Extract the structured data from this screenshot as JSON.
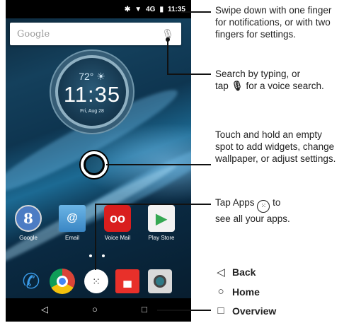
{
  "status_bar": {
    "time": "11:35",
    "icons": [
      "bluetooth-icon",
      "wifi-icon",
      "signal-4g-icon",
      "battery-icon"
    ],
    "network": "4G"
  },
  "search_bar": {
    "placeholder": "Google",
    "mic_icon": "mic-icon"
  },
  "clock_widget": {
    "temperature": "72°",
    "time": "11:35",
    "date": "Fri, Aug 28",
    "weather_icon": "sun-icon"
  },
  "apps": [
    {
      "label": "Google",
      "glyph": "8",
      "icon": "google-icon"
    },
    {
      "label": "Email",
      "glyph": "@",
      "icon": "email-icon"
    },
    {
      "label": "Voice Mail",
      "glyph": "oo",
      "icon": "voicemail-icon"
    },
    {
      "label": "Play Store",
      "glyph": "▶",
      "icon": "play-store-icon"
    }
  ],
  "dock": [
    "phone-icon",
    "chrome-icon",
    "apps-icon",
    "messaging-icon",
    "camera-icon"
  ],
  "dock_glyphs": {
    "phone": "✆",
    "apps": "⁙",
    "messaging": "▄"
  },
  "nav_bar": {
    "back": "◁",
    "home": "○",
    "overview": "□"
  },
  "callouts": {
    "notifications": [
      "Swipe down with one finger",
      "for notifications, or with two",
      "fingers for settings."
    ],
    "search_line1": "Search by typing, or",
    "search_line2_pre": "tap",
    "search_line2_post": "for a voice search.",
    "touch_hold": [
      "Touch and hold an empty",
      "spot to add widgets, change",
      "wallpaper, or adjust settings."
    ],
    "apps_line1_pre": "Tap Apps",
    "apps_line1_post": "to",
    "apps_line2": "see all your apps."
  },
  "legend": [
    {
      "glyph": "◁",
      "label": "Back"
    },
    {
      "glyph": "○",
      "label": "Home"
    },
    {
      "glyph": "□",
      "label": "Overview"
    }
  ],
  "colors": {
    "voicemail": "#d91e1e",
    "messaging": "#e8302a",
    "phone": "#3a9be8"
  }
}
